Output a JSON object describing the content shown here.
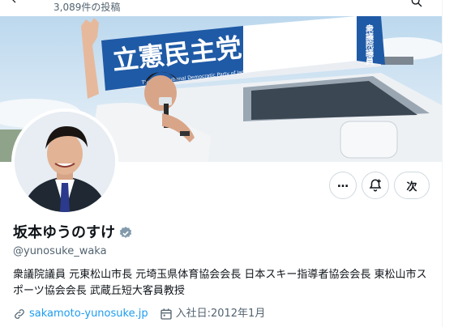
{
  "header": {
    "post_count": "3,089件の投稿"
  },
  "banner": {
    "sign_text": "立憲民主党",
    "sign_sub": "The Constitutional Democratic Party of Japan",
    "sign_side": "衆議院議員"
  },
  "profile": {
    "display_name": "坂本ゆうのすけ",
    "handle": "@yunosuke_waka",
    "bio": "衆議院議員 元東松山市長 元埼玉県体育協会会長 日本スキー指導者協会会長 東松山市スポーツ協会会長 武蔵丘短大客員教授",
    "website": "sakamoto-yunosuke.jp",
    "joined": "入社日:2012年1月",
    "verified_color": "#829aab"
  },
  "actions": {
    "more_label": "…",
    "next_label": "次"
  },
  "icons": {
    "back": "arrow-left-icon",
    "search": "search-icon",
    "more": "more-icon",
    "notify": "bell-plus-icon",
    "verified": "verified-badge-icon",
    "link": "link-icon",
    "calendar": "calendar-icon"
  },
  "colors": {
    "accent": "#1d9bf0",
    "muted": "#536471",
    "text": "#0f1419"
  }
}
